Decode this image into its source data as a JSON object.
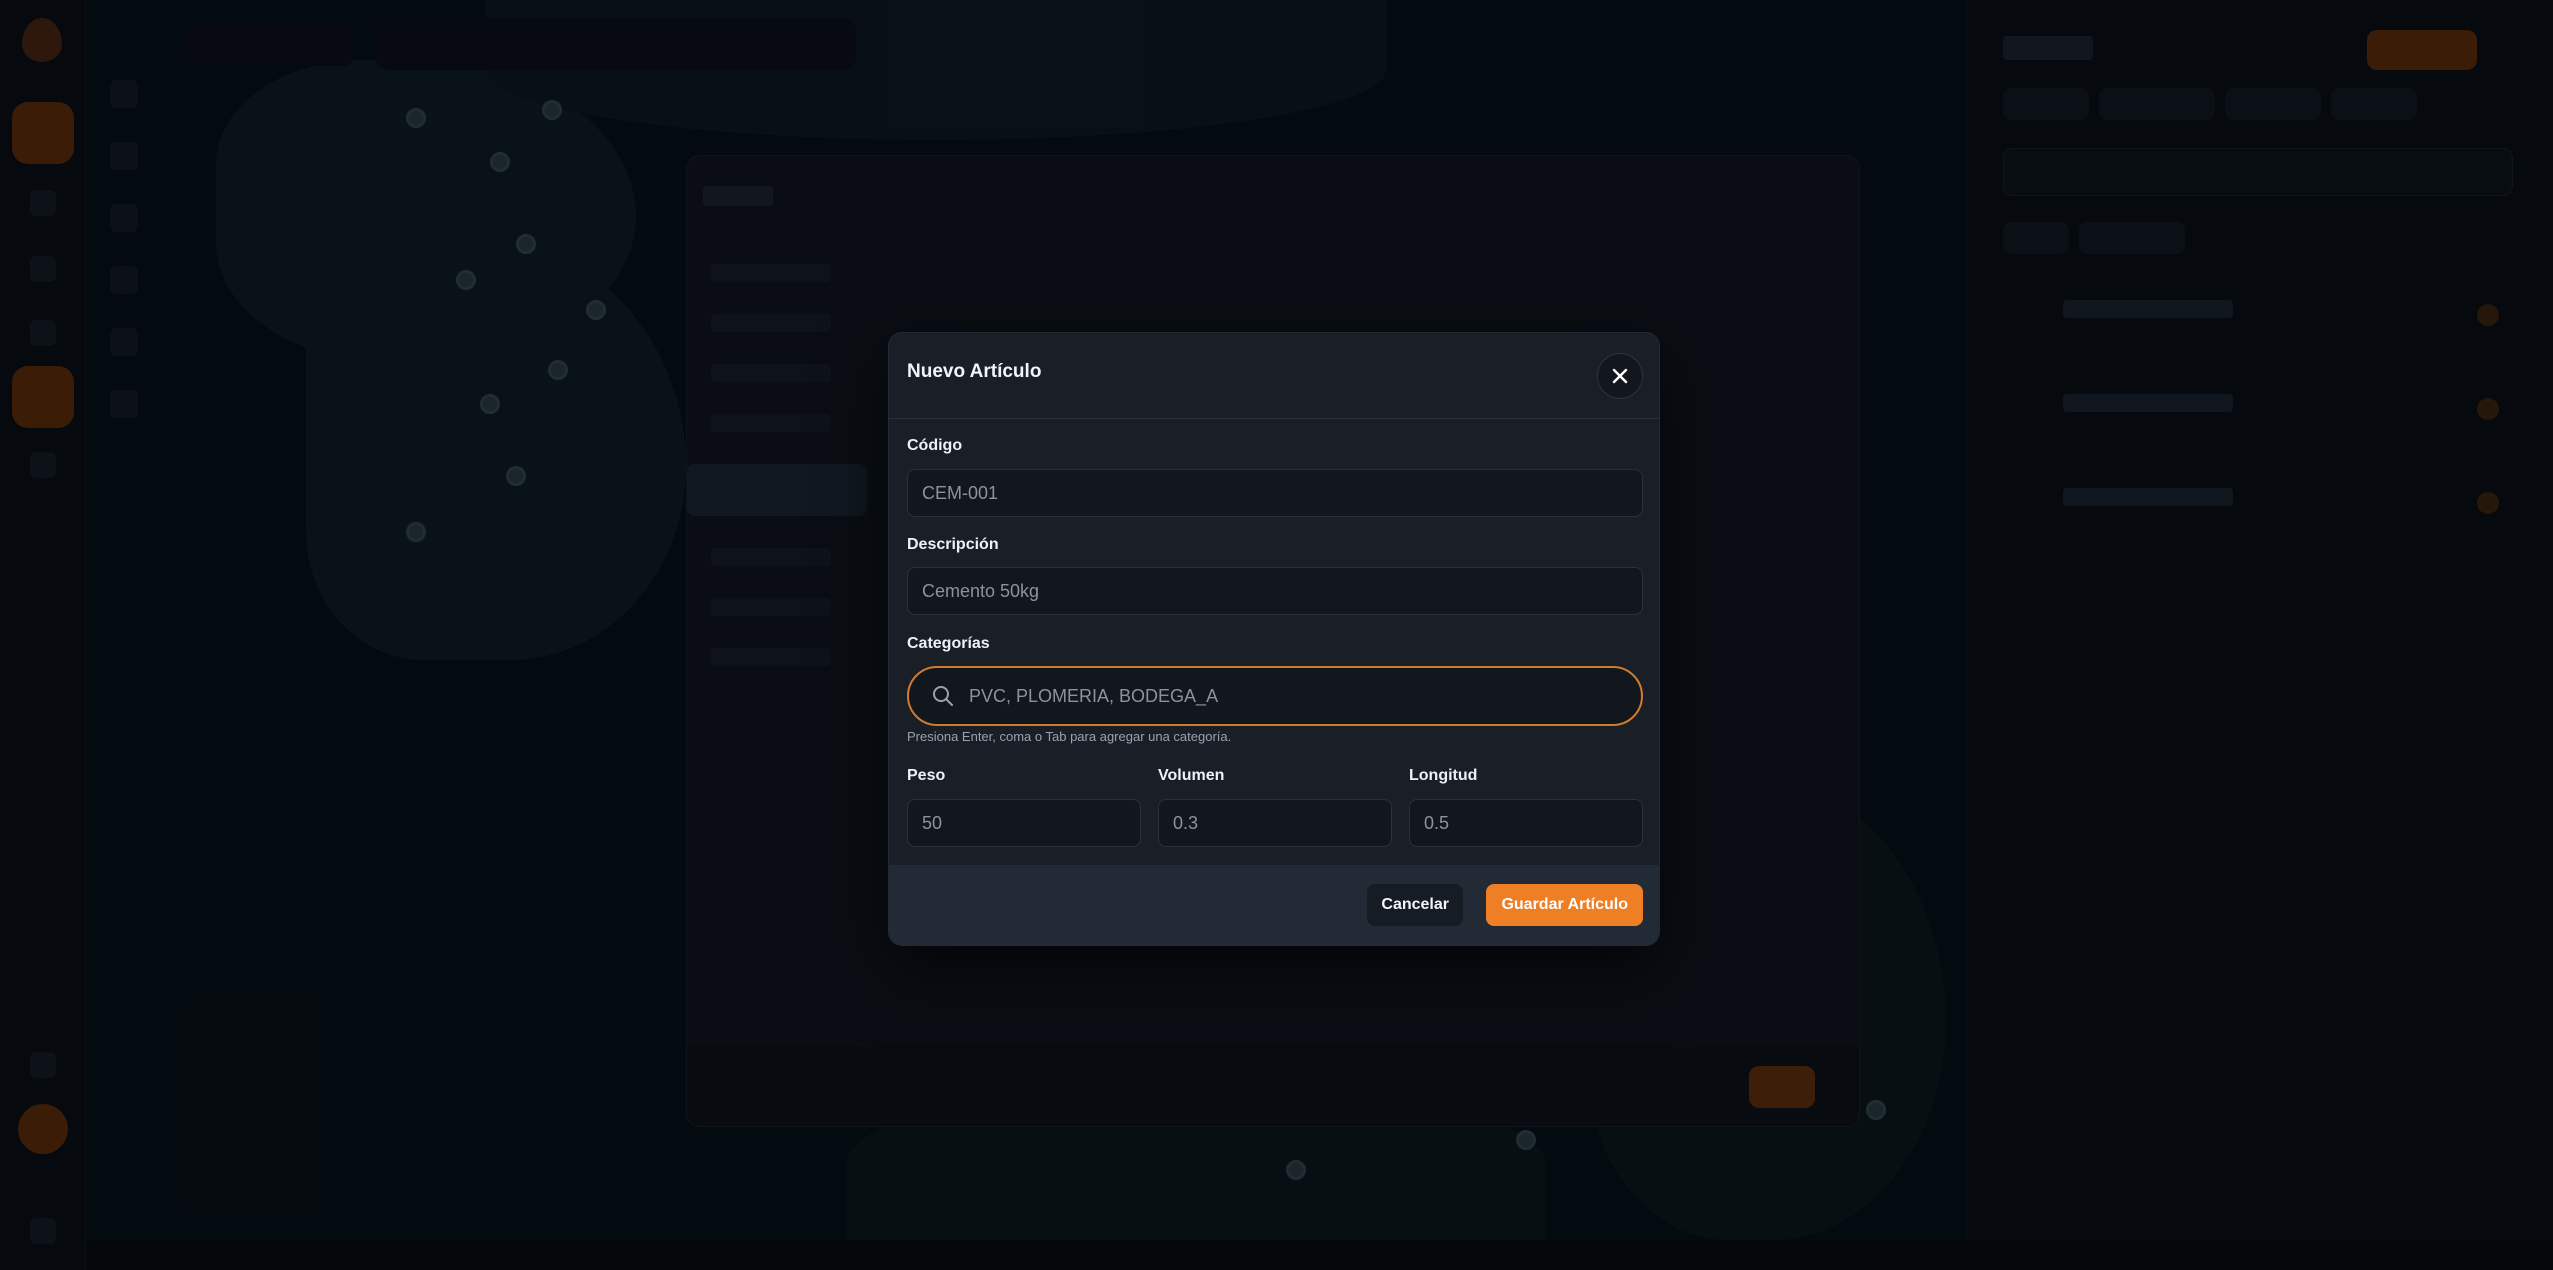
{
  "modal": {
    "title": "Nuevo Artículo",
    "fields": {
      "codigo": {
        "label": "Código",
        "value": "CEM-001"
      },
      "descripcion": {
        "label": "Descripción",
        "value": "Cemento 50kg"
      },
      "categorias": {
        "label": "Categorías",
        "value": "PVC, PLOMERIA, BODEGA_A",
        "hint": "Presiona Enter, coma o Tab para agregar una categoría."
      },
      "peso": {
        "label": "Peso",
        "value": "50"
      },
      "volumen": {
        "label": "Volumen",
        "value": "0.3"
      },
      "longitud": {
        "label": "Longitud",
        "value": "0.5"
      }
    },
    "buttons": {
      "cancel": "Cancelar",
      "save": "Guardar Artículo"
    }
  },
  "colors": {
    "accent": "#ee7f25",
    "focus_border": "#d27a2f",
    "modal_bg": "#1a1f27",
    "backdrop": "#05090f"
  },
  "icons": {
    "close": "close-icon",
    "search": "search-icon"
  }
}
